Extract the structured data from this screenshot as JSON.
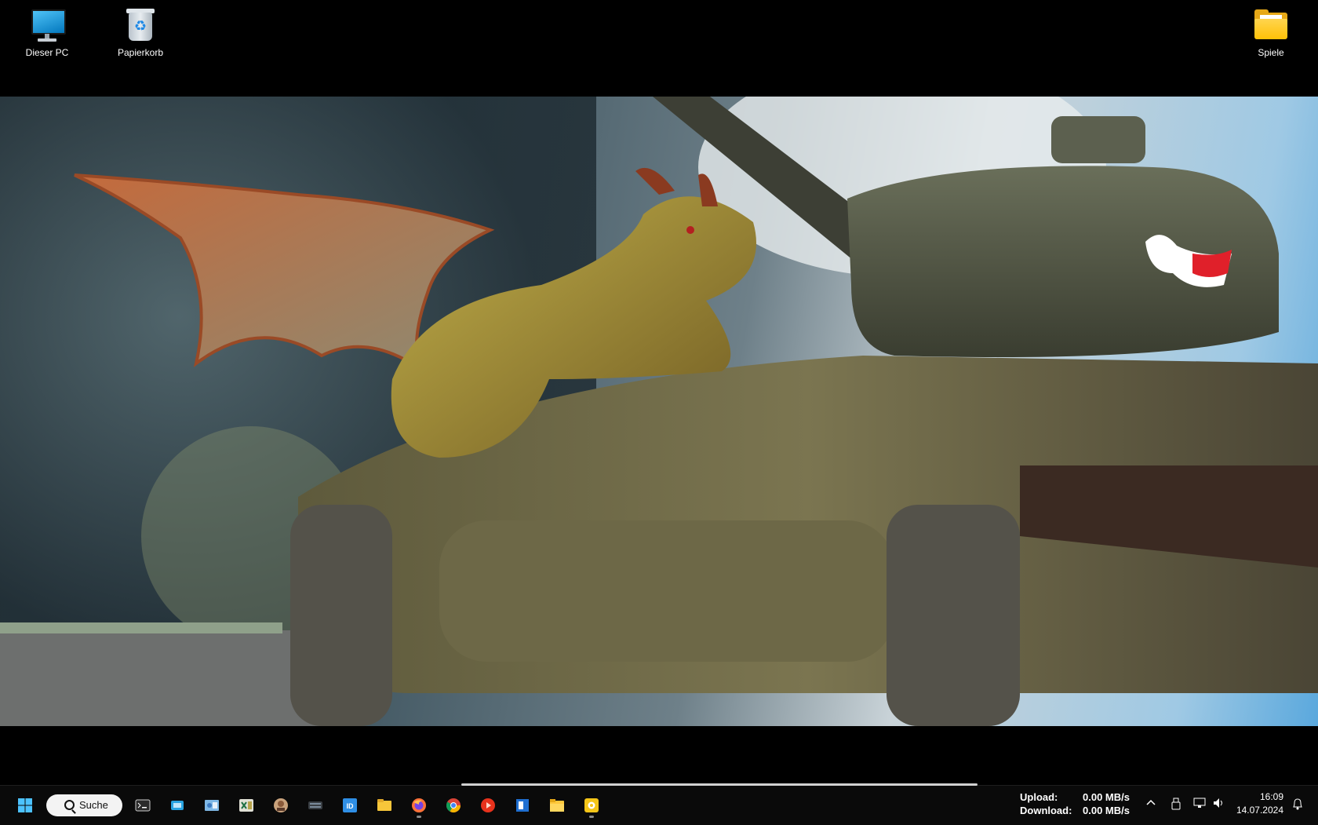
{
  "desktop": {
    "icons": [
      {
        "label": "Dieser PC",
        "icon": "monitor-icon"
      },
      {
        "label": "Papierkorb",
        "icon": "recycle-bin-icon"
      },
      {
        "label": "Spiele",
        "icon": "folder-icon"
      }
    ]
  },
  "wallpaper": {
    "subject": "dragon-on-tank",
    "colors": {
      "sky": "#5aa8dd",
      "smoke": "#3f5560",
      "ground": "#6d6f6e",
      "tank": "#4b5140",
      "dragon": "#9c8a2e",
      "wing": "#b2572c"
    }
  },
  "taskbar": {
    "start_icon": "windows-start-icon",
    "search": {
      "label": "Suche"
    },
    "apps": [
      {
        "icon": "terminal-icon"
      },
      {
        "icon": "app-window-icon"
      },
      {
        "icon": "control-panel-icon"
      },
      {
        "icon": "excel-icon"
      },
      {
        "icon": "contact-app-icon"
      },
      {
        "icon": "keyboard-app-icon"
      },
      {
        "icon": "indesign-icon"
      },
      {
        "icon": "file-explorer-icon"
      },
      {
        "icon": "firefox-icon",
        "running": true
      },
      {
        "icon": "chrome-icon"
      },
      {
        "icon": "media-player-icon"
      },
      {
        "icon": "notepad-app-icon"
      },
      {
        "icon": "folder-icon"
      },
      {
        "icon": "yellow-app-icon",
        "running": true
      }
    ],
    "network": {
      "upload_label": "Upload:",
      "upload_value": "0.00 MB/s",
      "download_label": "Download:",
      "download_value": "0.00 MB/s"
    },
    "tray_icons": [
      "chevron-up-icon",
      "usb-icon",
      "network-icon",
      "volume-icon"
    ],
    "clock": {
      "time": "16:09",
      "date": "14.07.2024"
    },
    "notification_icon": "bell-icon"
  }
}
